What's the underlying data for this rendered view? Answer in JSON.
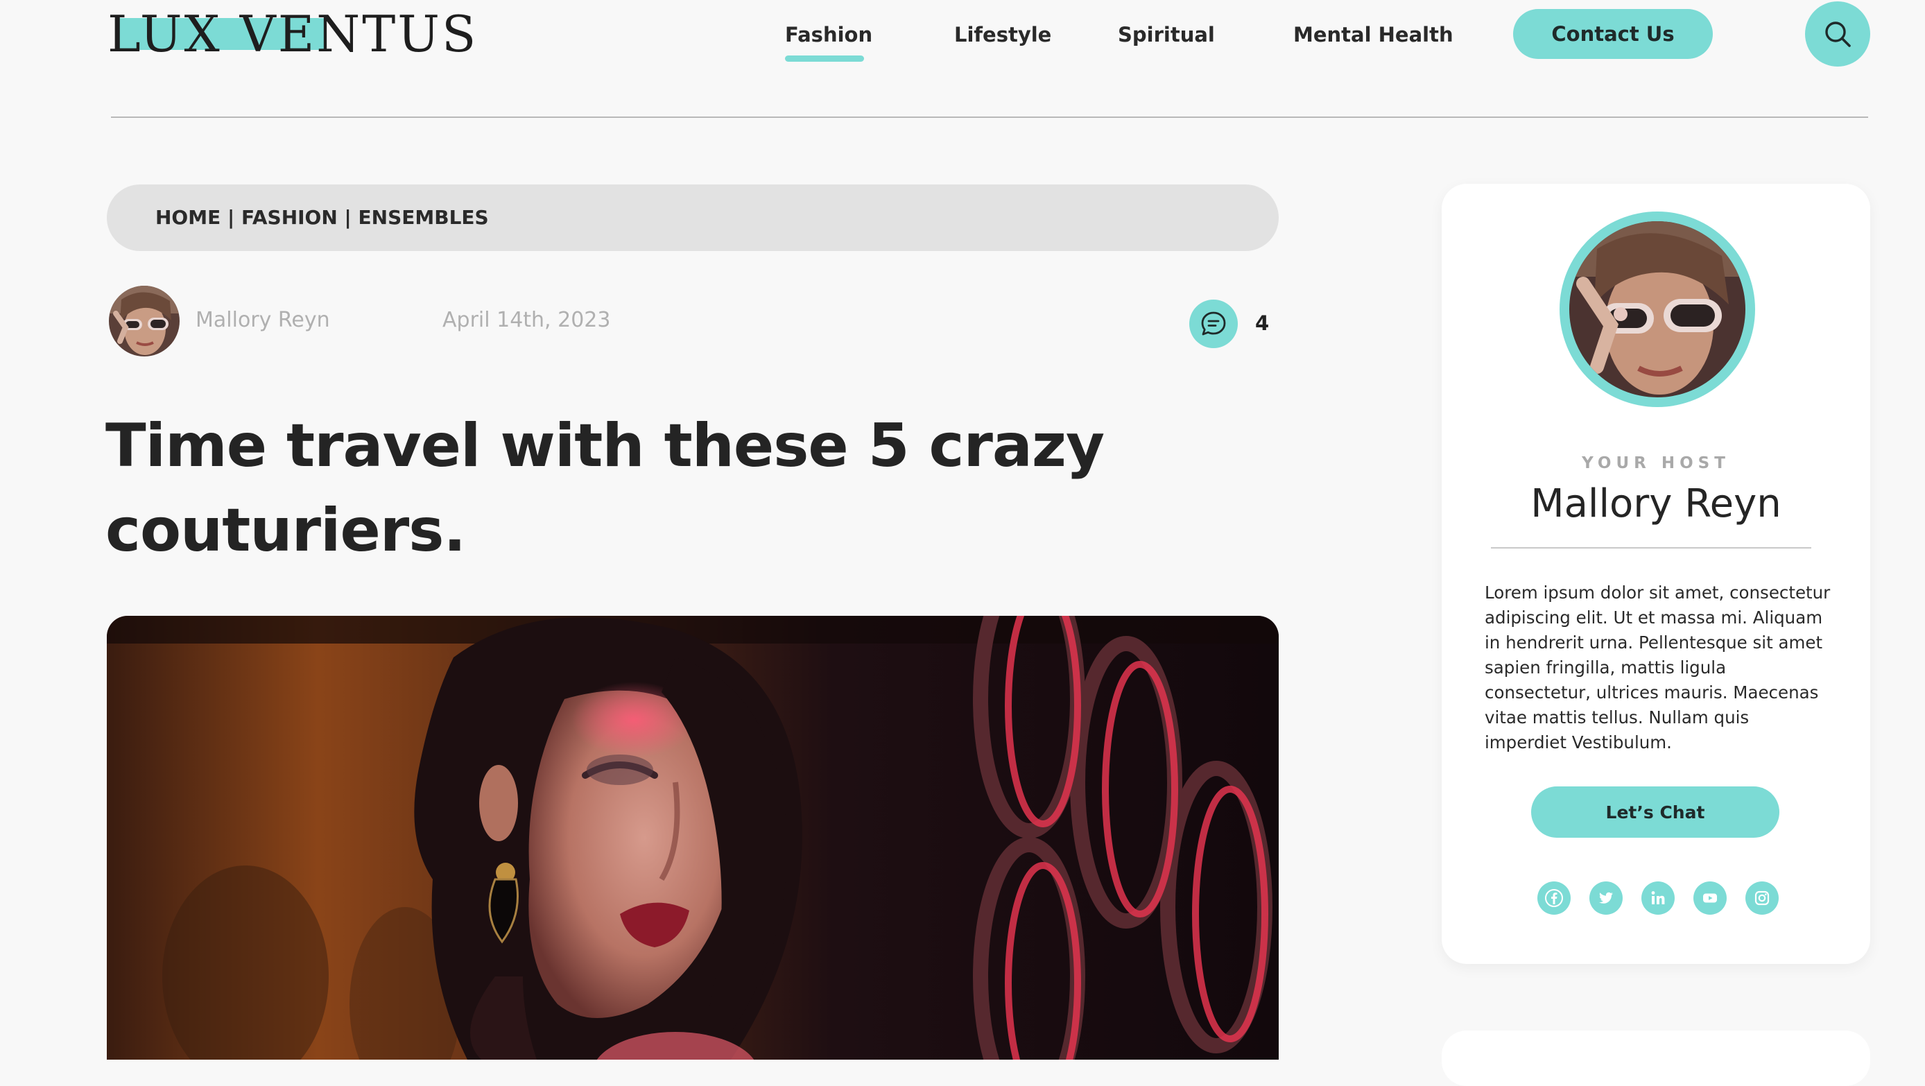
{
  "header": {
    "logo": "LUX VENTUS",
    "nav": [
      "Fashion",
      "Lifestyle",
      "Spiritual",
      "Mental Health"
    ],
    "active_nav": "Fashion",
    "contact_label": "Contact Us",
    "search_icon": "search-icon"
  },
  "breadcrumb": "HOME | FASHION |  ENSEMBLES",
  "post": {
    "author": "Mallory Reyn",
    "date": "April 14th, 2023",
    "comment_icon": "comment-icon",
    "comment_count": "4",
    "title": "Time travel with these 5 crazy couturiers."
  },
  "host": {
    "eyebrow": "YOUR HOST",
    "name": "Mallory Reyn",
    "bio": "Lorem ipsum dolor sit amet, consectetur adipiscing elit. Ut et massa mi. Aliquam in hendrerit urna. Pellentesque sit amet sapien fringilla, mattis ligula consectetur, ultrices mauris. Maecenas vitae mattis tellus. Nullam quis imperdiet Vestibulum.",
    "chat_label": "Let’s Chat",
    "socials": [
      "facebook-icon",
      "twitter-icon",
      "linkedin-icon",
      "youtube-icon",
      "instagram-icon"
    ]
  },
  "colors": {
    "accent": "#7cdbd5",
    "background": "#f8f8f8",
    "text": "#252525",
    "muted": "#b0b0b0",
    "breadcrumb_bg": "#e2e2e2"
  }
}
